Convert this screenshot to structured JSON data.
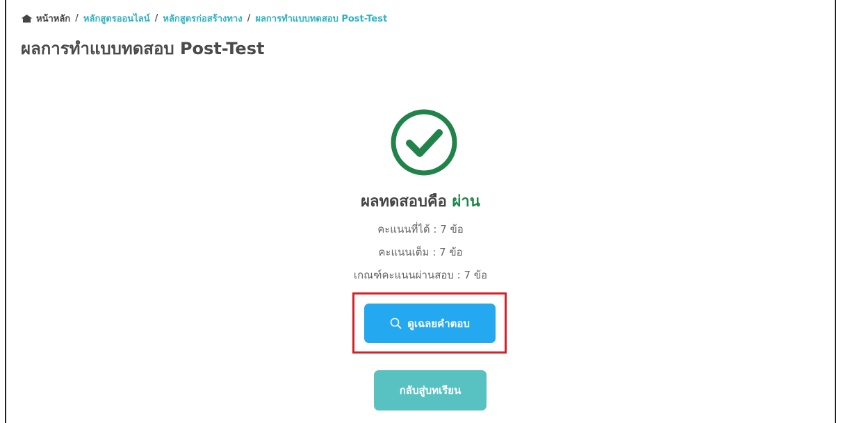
{
  "breadcrumb": {
    "home_label": "หน้าหลัก",
    "items": [
      "หลักสูตรออนไลน์",
      "หลักสูตรก่อสร้างทาง",
      "ผลการทำแบบทดสอบ Post-Test"
    ],
    "separator": "/"
  },
  "page_title": "ผลการทำแบบทดสอบ Post-Test",
  "result": {
    "prefix": "ผลทดสอบคือ",
    "status": "ผ่าน",
    "status_color": "#20834a",
    "icon": "check-circle-icon"
  },
  "scores": {
    "earned": "คะแนนที่ได้ : 7 ข้อ",
    "full": "คะแนนเต็ม : 7 ข้อ",
    "pass_criteria": "เกณฑ์คะแนนผ่านสอบ : 7 ข้อ"
  },
  "buttons": {
    "view_answers_label": "ดูเฉลยคำตอบ",
    "view_answers_icon": "search-icon",
    "view_answers_color": "#24a8ef",
    "back_label": "กลับสู่บทเรียน",
    "back_color": "#58c1c1"
  },
  "highlight_color": "#d42026"
}
